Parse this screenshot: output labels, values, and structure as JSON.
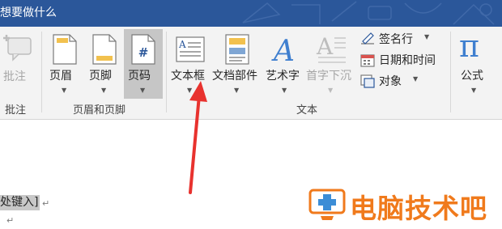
{
  "titlebar": {
    "tell_me": "想要做什么",
    "bg_color": "#2b579a"
  },
  "ribbon": {
    "groups": {
      "comments": {
        "label": "批注",
        "buttons": {
          "comment": "批注"
        }
      },
      "header_footer": {
        "label": "页眉和页脚",
        "buttons": {
          "header": "页眉",
          "footer": "页脚",
          "page_number": "页码"
        }
      },
      "text": {
        "label": "文本",
        "buttons": {
          "text_box": "文本框",
          "quick_parts": "文档部件",
          "wordart": "艺术字",
          "drop_cap": "首字下沉",
          "signature_line": "签名行",
          "date_time": "日期和时间",
          "object": "对象"
        }
      },
      "symbols": {
        "buttons": {
          "equation": "公式",
          "equation_symbol": "π"
        }
      }
    }
  },
  "document": {
    "placeholder": "处键入]",
    "para_mark": "↵"
  },
  "watermark": {
    "text": "电脑技术吧",
    "color": "#f07a1c"
  },
  "annotation": {
    "arrow_color": "#e8322e"
  }
}
